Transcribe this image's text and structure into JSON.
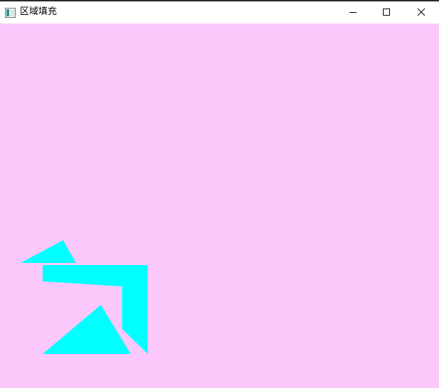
{
  "window": {
    "title": "区域填充",
    "app_icon": "window-app-icon",
    "controls": [
      "minimize-icon",
      "maximize-icon",
      "close-icon"
    ]
  },
  "canvas": {
    "background_color": "#fcc8fc",
    "fill_color": "#00ffff",
    "shapes_count_visible": 4
  }
}
